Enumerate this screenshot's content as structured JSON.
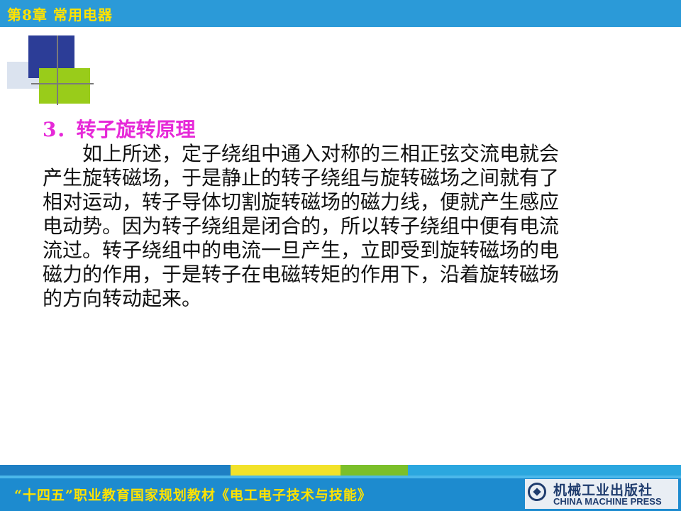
{
  "header": {
    "chapter_title": "第8章  常用电器",
    "bar_color": "#2b9ad8",
    "title_color": "#ffe200"
  },
  "section": {
    "number": "3．",
    "heading": "转子旋转原理",
    "heading_color": "#e629d8"
  },
  "body": {
    "lines": [
      "如上所述，定子绕组中通入对称的三相正弦交流电就会",
      "产生旋转磁场，于是静止的转子绕组与旋转磁场之间就有了",
      "相对运动，转子导体切割旋转磁场的磁力线，便就产生感应",
      "电动势。因为转子绕组是闭合的，所以转子绕组中便有电流",
      "流过。转子绕组中的电流一旦产生，立即受到旋转磁场的电",
      "磁力的作用，于是转子在电磁转矩的作用下，沿着旋转磁场",
      "的方向转动起来。"
    ]
  },
  "footer": {
    "series_title": "“十四五”职业教育国家规划教材《电工电子技术与技能》",
    "publisher_cn": "机械工业出版社",
    "publisher_en": "CHINA MACHINE PRESS",
    "logo_icon": "publisher-logo-icon"
  }
}
